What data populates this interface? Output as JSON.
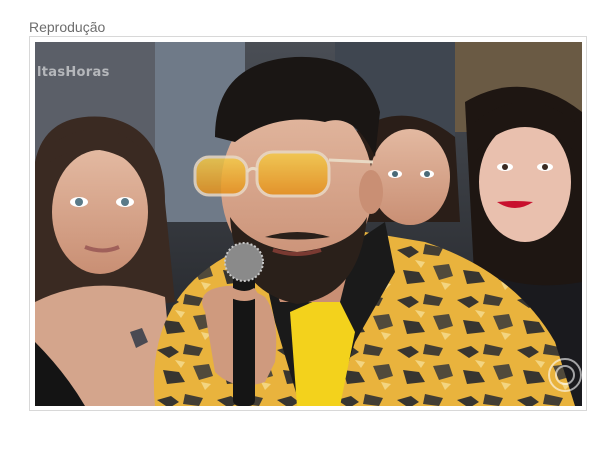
{
  "caption": {
    "label": "Reprodução"
  },
  "photo": {
    "watermark_text": "ltasHoras",
    "logo_icon": "globo-logo-icon"
  },
  "colors": {
    "caption_text": "#6d6d6d",
    "frame_border": "#d8d8d8"
  }
}
